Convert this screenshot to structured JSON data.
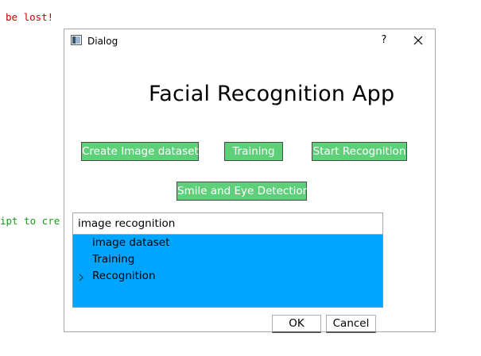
{
  "background": {
    "red_text": "be lost!",
    "green_text": "ipt to cre"
  },
  "dialog": {
    "title": "Dialog",
    "help_label": "?",
    "app_title": "Facial Recognition App",
    "buttons": {
      "create_dataset": "Create Image dataset",
      "training": "Training",
      "start_recognition": "Start Recognition",
      "smile_eye": "Smile and Eye Detection"
    },
    "search": {
      "value": "image recognition"
    },
    "tree_items": [
      "image dataset",
      "Training",
      "Recognition"
    ],
    "ok_label": "OK",
    "cancel_label": "Cancel"
  },
  "colors": {
    "button_green": "#5fd07a",
    "tree_highlight": "#00a5ff"
  }
}
